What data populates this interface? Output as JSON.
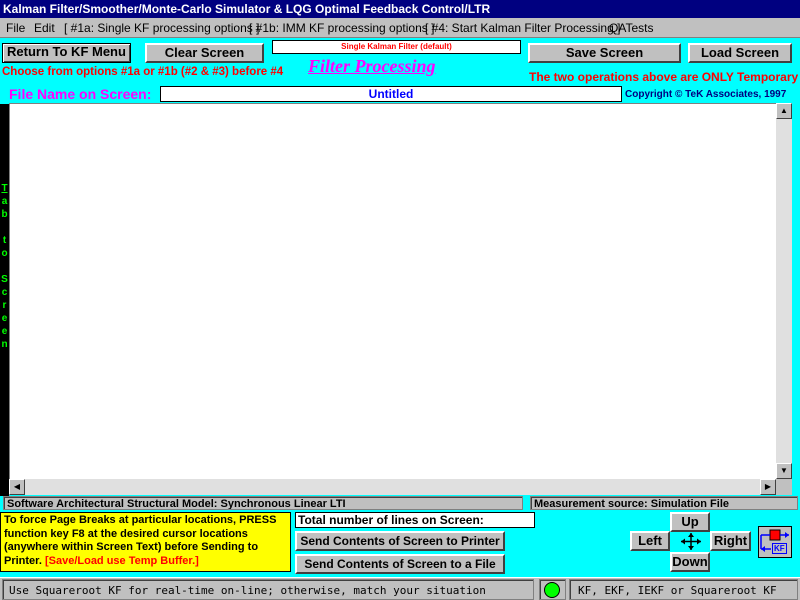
{
  "window": {
    "title": "Kalman Filter/Smoother/Monte-Carlo Simulator & LQG Optimal Feedback Control/LTR"
  },
  "menu": {
    "items": [
      "File",
      "Edit",
      "[ #1a: Single KF processing options ]",
      "[ #1b: IMM KF processing options ]",
      "[ #4: Start Kalman Filter Processing ]",
      "QATests"
    ]
  },
  "toolbar": {
    "return_label": "Return To KF Menu",
    "clear_label": "Clear Screen",
    "mode_text": "Single Kalman Filter (default)",
    "save_label": "Save Screen",
    "load_label": "Load Screen"
  },
  "notes": {
    "choose_text": "Choose from options #1a or #1b (#2 & #3) before #4",
    "heading": "Filter Processing",
    "temporary_text": "The two operations above are ONLY Temporary"
  },
  "file": {
    "label": "File Name on Screen:",
    "name": "Untitled",
    "copyright": "Copyright © TeK Associates, 1997"
  },
  "side": {
    "letters": [
      "T",
      "a",
      "b",
      "",
      "t",
      "o",
      "",
      "S",
      "c",
      "r",
      "e",
      "e",
      "n"
    ]
  },
  "status": {
    "model": "Software Architectural Structural Model:  Synchronous Linear LTI",
    "measurement": "Measurement source:  Simulation File"
  },
  "instructions": {
    "text": "To force  Page Breaks at particular locations, PRESS function key F8 at the desired cursor locations (anywhere within Screen Text) before Sending to Printer. ",
    "hint": "[Save/Load use Temp Buffer.]"
  },
  "lines": {
    "label": "Total number of lines on Screen:"
  },
  "actions": {
    "printer_label": "Send  Contents of Screen to Printer",
    "file_label": "Send Contents of Screen to a File"
  },
  "nav": {
    "up": "Up",
    "left": "Left",
    "right": "Right",
    "down": "Down",
    "badge": "KF"
  },
  "footer": {
    "hint": "Use Squareroot KF for real-time on-line; otherwise, match your situation",
    "variants": "KF, EKF, IEKF or Squareroot KF"
  },
  "colors": {
    "background": "#00ffff",
    "title_bar": "#000080",
    "heading": "#ff00ff",
    "warning": "#ff0000",
    "file_label": "#ff00ff",
    "indicator": "#00ff00"
  }
}
